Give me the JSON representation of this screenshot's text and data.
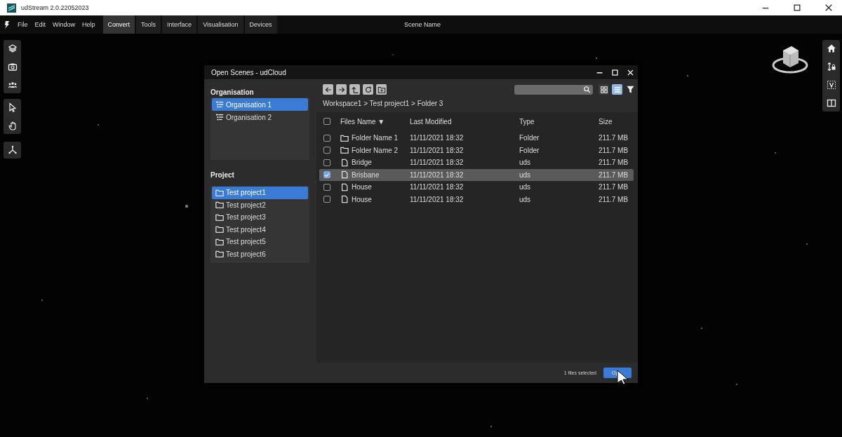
{
  "app": {
    "title": "udStream 2.0.22052023"
  },
  "menu": [
    {
      "label": "File",
      "kind": "menu"
    },
    {
      "label": "Edit",
      "kind": "menu"
    },
    {
      "label": "Window",
      "kind": "menu"
    },
    {
      "label": "Help",
      "kind": "menu"
    },
    {
      "label": "Convert",
      "kind": "tab",
      "selected": true
    },
    {
      "label": "Tools",
      "kind": "tab",
      "selected": false
    },
    {
      "label": "Interface",
      "kind": "tab",
      "selected": false
    },
    {
      "label": "Visualisation",
      "kind": "tab",
      "selected": false
    },
    {
      "label": "Devices",
      "kind": "tab",
      "selected": false
    }
  ],
  "scene_name": "Scene Name",
  "dialog": {
    "title": "Open Scenes - udCloud",
    "organisation": {
      "heading": "Organisation",
      "items": [
        {
          "label": "Organisation 1",
          "selected": true
        },
        {
          "label": "Organisation 2",
          "selected": false
        }
      ]
    },
    "project": {
      "heading": "Project",
      "items": [
        {
          "label": "Test project1",
          "selected": true
        },
        {
          "label": "Test project2",
          "selected": false
        },
        {
          "label": "Test project3",
          "selected": false
        },
        {
          "label": "Test project4",
          "selected": false
        },
        {
          "label": "Test project5",
          "selected": false
        },
        {
          "label": "Test project6",
          "selected": false
        }
      ]
    },
    "view_modes": [
      {
        "kind": "grid",
        "selected": false
      },
      {
        "kind": "list",
        "selected": true
      }
    ],
    "breadcrumb": "Workspace1 > Test project1 > Folder 3",
    "table": {
      "all_checked": false,
      "columns": [
        {
          "label": "Files Name",
          "sort_mark": "▼"
        },
        {
          "label": "Last Modified"
        },
        {
          "label": "Type"
        },
        {
          "label": "Size"
        }
      ],
      "rows": [
        {
          "kind": "folder",
          "name": "Folder Name 1",
          "modified": "11/11/2021 18:32",
          "type": "Folder",
          "size": "211.7 MB",
          "checked": false,
          "selected": false
        },
        {
          "kind": "folder",
          "name": "Folder Name 2",
          "modified": "11/11/2021 18:32",
          "type": "Folder",
          "size": "211.7 MB",
          "checked": false,
          "selected": false
        },
        {
          "kind": "file",
          "name": "Bridge",
          "modified": "11/11/2021 18:32",
          "type": "uds",
          "size": "211.7 MB",
          "checked": false,
          "selected": false
        },
        {
          "kind": "file",
          "name": "Brisbane",
          "modified": "11/11/2021 18:32",
          "type": "uds",
          "size": "211.7 MB",
          "checked": true,
          "selected": true
        },
        {
          "kind": "file",
          "name": "House",
          "modified": "11/11/2021 18:32",
          "type": "uds",
          "size": "211.7 MB",
          "checked": false,
          "selected": false
        },
        {
          "kind": "file",
          "name": "House",
          "modified": "11/11/2021 18:32",
          "type": "uds",
          "size": "211.7 MB",
          "checked": false,
          "selected": false
        }
      ]
    },
    "status": "1 files selected",
    "open_button": "Op"
  }
}
